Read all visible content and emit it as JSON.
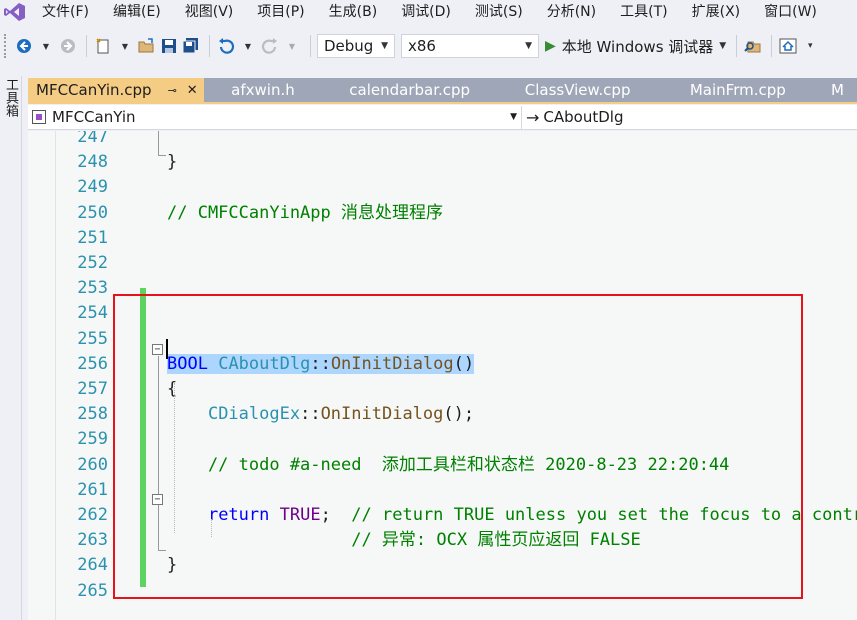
{
  "menu": {
    "items": [
      "文件(F)",
      "编辑(E)",
      "视图(V)",
      "项目(P)",
      "生成(B)",
      "调试(D)",
      "测试(S)",
      "分析(N)",
      "工具(T)",
      "扩展(X)",
      "窗口(W)"
    ]
  },
  "toolbar": {
    "config": "Debug",
    "platform": "x86",
    "run_label": "本地 Windows 调试器"
  },
  "side": {
    "toolbox_label": "工具箱"
  },
  "tabs": [
    {
      "label": "MFCCanYin.cpp",
      "active": true
    },
    {
      "label": "afxwin.h"
    },
    {
      "label": "calendarbar.cpp"
    },
    {
      "label": "ClassView.cpp"
    },
    {
      "label": "MainFrm.cpp"
    },
    {
      "label": "M"
    }
  ],
  "navbar": {
    "project": "MFCCanYin",
    "scope": "CAboutDlg"
  },
  "editor": {
    "lines": [
      {
        "n": "247",
        "tokens": []
      },
      {
        "n": "248",
        "tokens": [
          {
            "t": "}",
            "c": "c-plain"
          }
        ]
      },
      {
        "n": "249",
        "tokens": []
      },
      {
        "n": "250",
        "tokens": [
          {
            "t": "// CMFCCanYinApp 消息处理程序",
            "c": "c-comment"
          }
        ]
      },
      {
        "n": "251",
        "tokens": []
      },
      {
        "n": "252",
        "tokens": []
      },
      {
        "n": "253",
        "tokens": []
      },
      {
        "n": "254",
        "tokens": []
      },
      {
        "n": "255",
        "tokens": []
      },
      {
        "n": "256",
        "tokens": [
          {
            "t": "BOOL",
            "c": "c-type sel"
          },
          {
            "t": " ",
            "c": "c-plain sel"
          },
          {
            "t": "CAboutDlg",
            "c": "c-class sel"
          },
          {
            "t": "::",
            "c": "c-plain sel"
          },
          {
            "t": "OnInitDialog",
            "c": "c-func sel"
          },
          {
            "t": "()",
            "c": "c-plain sel"
          }
        ]
      },
      {
        "n": "257",
        "tokens": [
          {
            "t": "{",
            "c": "c-plain"
          }
        ]
      },
      {
        "n": "258",
        "tokens": [
          {
            "t": "    ",
            "c": "c-plain"
          },
          {
            "t": "CDialogEx",
            "c": "c-class"
          },
          {
            "t": "::",
            "c": "c-plain"
          },
          {
            "t": "OnInitDialog",
            "c": "c-func"
          },
          {
            "t": "();",
            "c": "c-plain"
          }
        ]
      },
      {
        "n": "259",
        "tokens": []
      },
      {
        "n": "260",
        "tokens": [
          {
            "t": "    // todo #a-need  添加工具栏和状态栏 2020-8-23 22:20:44",
            "c": "c-comment"
          }
        ]
      },
      {
        "n": "261",
        "tokens": []
      },
      {
        "n": "262",
        "tokens": [
          {
            "t": "    ",
            "c": "c-plain"
          },
          {
            "t": "return",
            "c": "c-type"
          },
          {
            "t": " ",
            "c": "c-plain"
          },
          {
            "t": "TRUE",
            "c": "c-macro"
          },
          {
            "t": ";  ",
            "c": "c-plain"
          },
          {
            "t": "// return TRUE unless you set the focus to a contr",
            "c": "c-comment"
          }
        ]
      },
      {
        "n": "263",
        "tokens": [
          {
            "t": "                  // 异常: OCX 属性页应返回 FALSE",
            "c": "c-comment"
          }
        ]
      },
      {
        "n": "264",
        "tokens": [
          {
            "t": "}",
            "c": "c-plain"
          }
        ]
      },
      {
        "n": "265",
        "tokens": []
      }
    ]
  }
}
